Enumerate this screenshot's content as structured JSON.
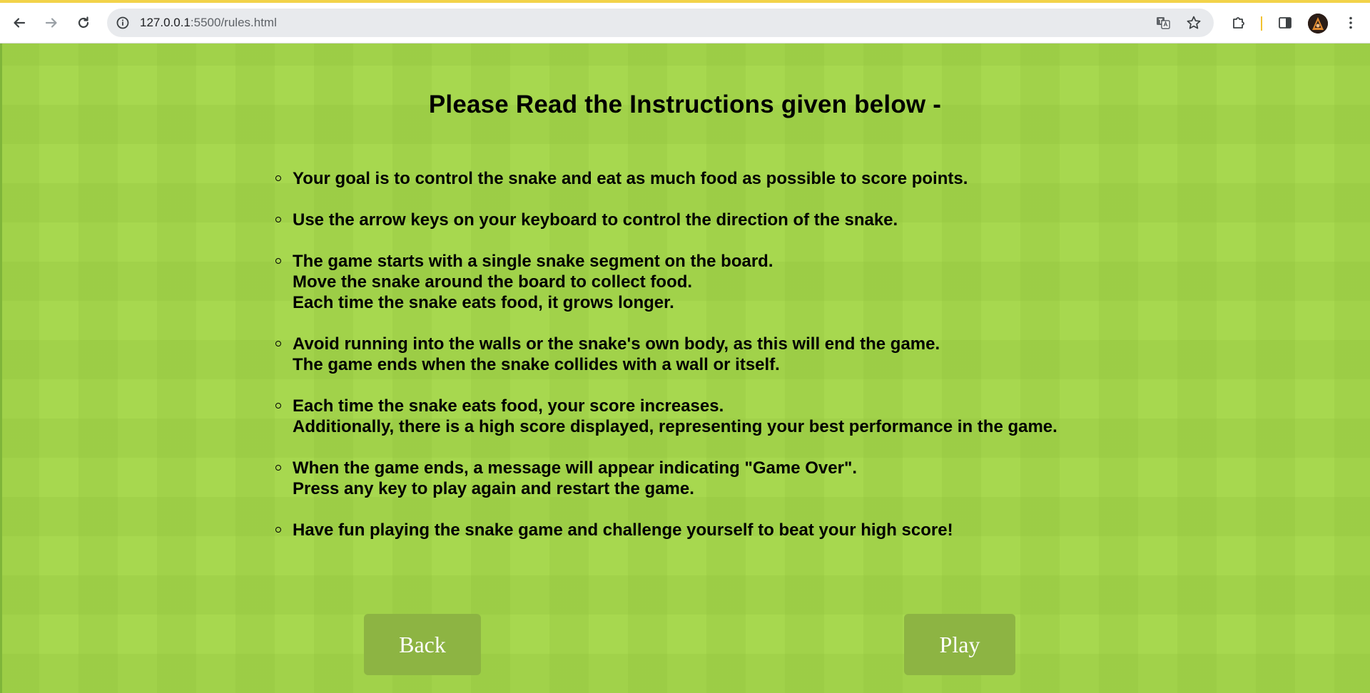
{
  "browser": {
    "url_host": "127.0.0.1",
    "url_path": ":5500/rules.html",
    "icons": {
      "back": "arrow-left-icon",
      "forward": "arrow-right-icon",
      "reload": "reload-icon",
      "site_info": "info-icon",
      "translate": "translate-icon",
      "bookmark": "star-icon",
      "extensions": "puzzle-icon",
      "side_panel": "side-panel-icon",
      "menu": "kebab-menu-icon"
    },
    "accent_color": "#f2d34a"
  },
  "page": {
    "title": "Please Read the Instructions given below -",
    "background_color": "#a7d84f",
    "rules": [
      {
        "lines": [
          "Your goal is to control the snake and eat as much food as possible to score points."
        ]
      },
      {
        "lines": [
          "Use the arrow keys on your keyboard to control the direction of the snake."
        ]
      },
      {
        "lines": [
          "The game starts with a single snake segment on the board.",
          "Move the snake around the board to collect food.",
          "Each time the snake eats food, it grows longer."
        ]
      },
      {
        "lines": [
          "Avoid running into the walls or the snake's own body, as this will end the game.",
          "The game ends when the snake collides with a wall or itself."
        ]
      },
      {
        "lines": [
          "Each time the snake eats food, your score increases.",
          "Additionally, there is a high score displayed, representing your best performance in the game."
        ]
      },
      {
        "lines": [
          "When the game ends, a message will appear indicating \"Game Over\".",
          "Press any key to play again and restart the game."
        ]
      },
      {
        "lines": [
          "Have fun playing the snake game and challenge yourself to beat your high score!"
        ]
      }
    ],
    "buttons": {
      "back_label": "Back",
      "play_label": "Play",
      "color": "#8db443"
    }
  }
}
